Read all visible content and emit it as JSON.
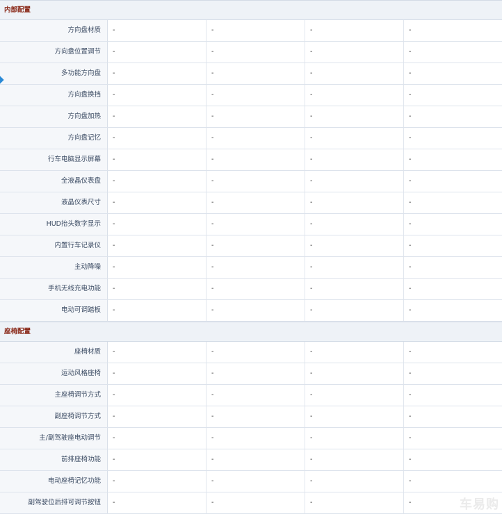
{
  "sections": [
    {
      "title": "内部配置",
      "rows": [
        {
          "label": "方向盘材质",
          "values": [
            "-",
            "-",
            "-",
            "-"
          ]
        },
        {
          "label": "方向盘位置调节",
          "values": [
            "-",
            "-",
            "-",
            "-"
          ]
        },
        {
          "label": "多功能方向盘",
          "values": [
            "-",
            "-",
            "-",
            "-"
          ]
        },
        {
          "label": "方向盘换挡",
          "values": [
            "-",
            "-",
            "-",
            "-"
          ]
        },
        {
          "label": "方向盘加热",
          "values": [
            "-",
            "-",
            "-",
            "-"
          ]
        },
        {
          "label": "方向盘记忆",
          "values": [
            "-",
            "-",
            "-",
            "-"
          ]
        },
        {
          "label": "行车电脑显示屏幕",
          "values": [
            "-",
            "-",
            "-",
            "-"
          ]
        },
        {
          "label": "全液晶仪表盘",
          "values": [
            "-",
            "-",
            "-",
            "-"
          ]
        },
        {
          "label": "液晶仪表尺寸",
          "values": [
            "-",
            "-",
            "-",
            "-"
          ]
        },
        {
          "label": "HUD抬头数字显示",
          "values": [
            "-",
            "-",
            "-",
            "-"
          ]
        },
        {
          "label": "内置行车记录仪",
          "values": [
            "-",
            "-",
            "-",
            "-"
          ]
        },
        {
          "label": "主动降噪",
          "values": [
            "-",
            "-",
            "-",
            "-"
          ]
        },
        {
          "label": "手机无线充电功能",
          "values": [
            "-",
            "-",
            "-",
            "-"
          ]
        },
        {
          "label": "电动可调踏板",
          "values": [
            "-",
            "-",
            "-",
            "-"
          ]
        }
      ]
    },
    {
      "title": "座椅配置",
      "rows": [
        {
          "label": "座椅材质",
          "values": [
            "-",
            "-",
            "-",
            "-"
          ]
        },
        {
          "label": "运动风格座椅",
          "values": [
            "-",
            "-",
            "-",
            "-"
          ]
        },
        {
          "label": "主座椅调节方式",
          "values": [
            "-",
            "-",
            "-",
            "-"
          ]
        },
        {
          "label": "副座椅调节方式",
          "values": [
            "-",
            "-",
            "-",
            "-"
          ]
        },
        {
          "label": "主/副驾驶座电动调节",
          "values": [
            "-",
            "-",
            "-",
            "-"
          ]
        },
        {
          "label": "前排座椅功能",
          "values": [
            "-",
            "-",
            "-",
            "-"
          ]
        },
        {
          "label": "电动座椅记忆功能",
          "values": [
            "-",
            "-",
            "-",
            "-"
          ]
        },
        {
          "label": "副驾驶位后排可调节按钮",
          "values": [
            "-",
            "-",
            "-",
            "-"
          ]
        }
      ]
    }
  ],
  "watermark": "车易购",
  "colors": {
    "section_title": "#8a2a1a",
    "label_bg": "#f5f7fa",
    "header_bg": "#eef2f7",
    "marker": "#2b8ad6"
  }
}
